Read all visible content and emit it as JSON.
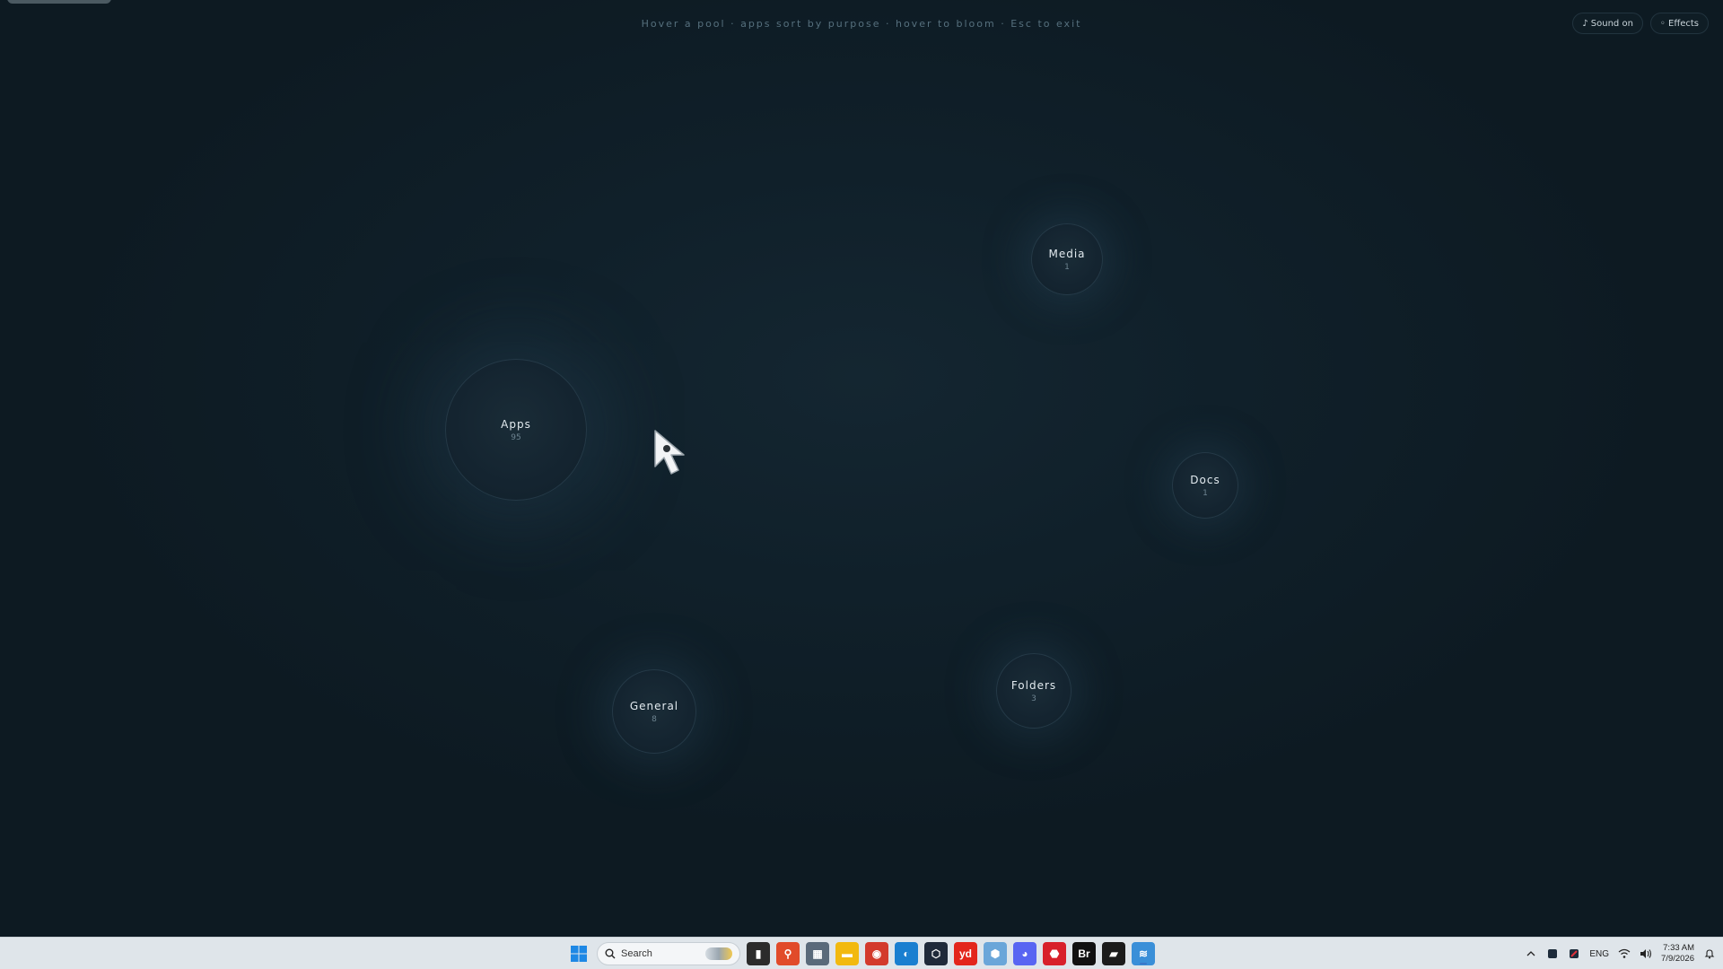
{
  "hint": "Hover a pool · apps sort by purpose · hover to bloom · Esc to exit",
  "controls": {
    "sound_label": "♪ Sound on",
    "effects_label": "◦ Effects"
  },
  "pools": [
    {
      "label": "Media",
      "count": "1"
    },
    {
      "label": "Apps",
      "count": "95"
    },
    {
      "label": "Docs",
      "count": "1"
    },
    {
      "label": "General",
      "count": "8"
    },
    {
      "label": "Folders",
      "count": "3"
    }
  ],
  "taskbar": {
    "search_placeholder": "Search",
    "apps": [
      {
        "name": "task-view-icon",
        "glyph": "▮",
        "color": "#2b2b2b"
      },
      {
        "name": "magnifier-app-icon",
        "glyph": "⚲",
        "color": "#e14b2a"
      },
      {
        "name": "calculator-icon",
        "glyph": "▦",
        "color": "#5a6a7a"
      },
      {
        "name": "file-explorer-icon",
        "glyph": "▬",
        "color": "#f2b90f"
      },
      {
        "name": "chrome-icon",
        "glyph": "◉",
        "color": "#d33a2c"
      },
      {
        "name": "edge-icon",
        "glyph": "◐",
        "color": "#1a7fd0"
      },
      {
        "name": "app-hex-icon",
        "glyph": "⬡",
        "color": "#1f2a3a"
      },
      {
        "name": "youdao-icon",
        "glyph": "yd",
        "color": "#e3261c"
      },
      {
        "name": "sandbox-icon",
        "glyph": "⬢",
        "color": "#6aa6d9"
      },
      {
        "name": "discord-icon",
        "glyph": "◕",
        "color": "#5865f2"
      },
      {
        "name": "security-app-icon",
        "glyph": "⬣",
        "color": "#d8202a"
      },
      {
        "name": "bridge-icon",
        "glyph": "Br",
        "color": "#111111"
      },
      {
        "name": "terminal-app-icon",
        "glyph": "▰",
        "color": "#1b1b1b"
      },
      {
        "name": "pools-app-icon",
        "glyph": "≋",
        "color": "#3a8fd8"
      }
    ],
    "tray": {
      "language": "ENG",
      "time": "7:33 AM",
      "date": "7/9/2026"
    }
  }
}
